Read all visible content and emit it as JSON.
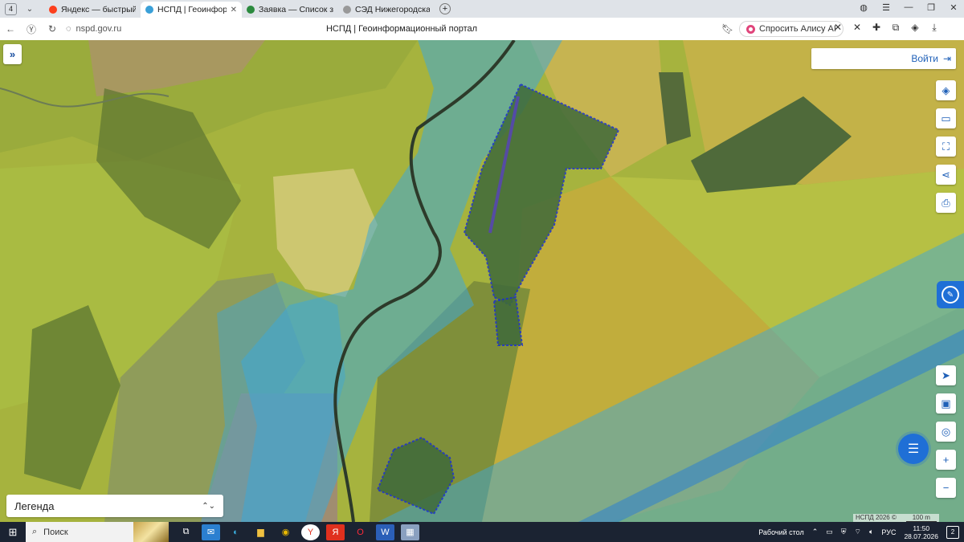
{
  "browser": {
    "tab_count": "4",
    "tabs": [
      {
        "title": "Яндекс — быстрый поиск",
        "fav_color": "#fc3f1d",
        "active": false
      },
      {
        "title": "НСПД | Геоинформаци",
        "fav_color": "#3aa0d8",
        "active": true
      },
      {
        "title": "Заявка — Список заявок",
        "fav_color": "#2b8a3e",
        "active": false
      },
      {
        "title": "СЭД Нижегородская обл.",
        "fav_color": "#999999",
        "active": false
      }
    ],
    "url": "nspd.gov.ru",
    "page_title": "НСПД | Геоинформационный портал",
    "alice_label": "Спросить Алису AI"
  },
  "map": {
    "login_label": "Войти",
    "legend_label": "Легенда",
    "attribution": "НСПД 2026 ©",
    "scale_label": "100 m",
    "tools": [
      "layers-icon",
      "ruler-icon",
      "select-area-icon",
      "share-icon",
      "print-icon"
    ],
    "controls": [
      "locate-icon",
      "minimap-icon",
      "pin-icon",
      "zoom-in-icon",
      "zoom-out-icon"
    ]
  },
  "taskbar": {
    "search_label": "Поиск",
    "desktop_label": "Рабочий стол",
    "lang": "РУС",
    "time": "11:50",
    "date": "28.07.2026",
    "notifications": "2"
  },
  "colors": {
    "zone_blue": "#3fa7d6",
    "parcel_border": "#1a2fd0",
    "field_yellow": "#b8b640",
    "ui_accent": "#1f6fd6"
  }
}
